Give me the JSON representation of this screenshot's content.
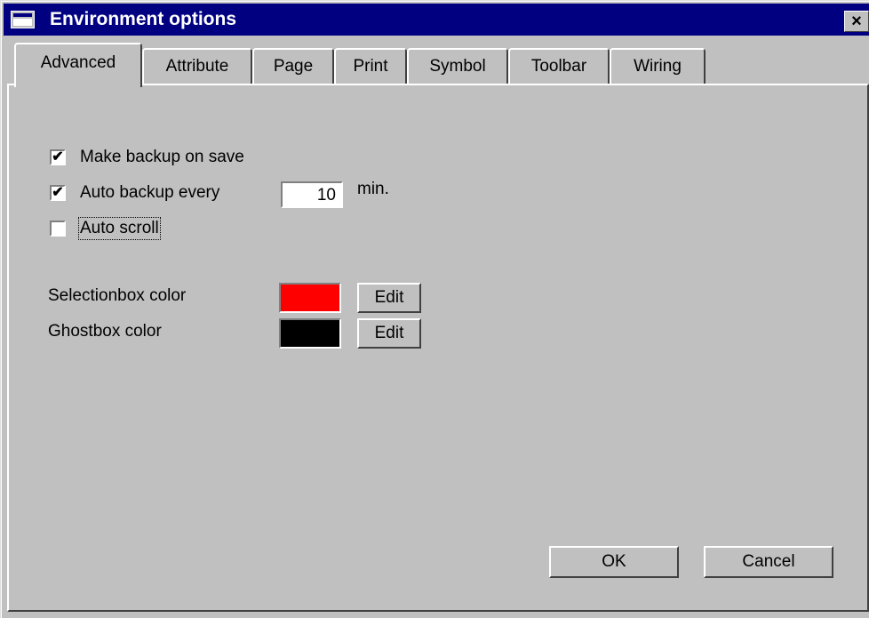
{
  "window": {
    "title": "Environment options",
    "close_label": "×"
  },
  "tabs": [
    "Advanced",
    "Attribute",
    "Page",
    "Print",
    "Symbol",
    "Toolbar",
    "Wiring"
  ],
  "options": {
    "make_backup": {
      "label": "Make backup on save",
      "checked": true
    },
    "auto_backup": {
      "label": "Auto backup every",
      "checked": true,
      "value": "10",
      "unit": "min."
    },
    "auto_scroll": {
      "label": "Auto scroll",
      "checked": false
    }
  },
  "colors": {
    "selectionbox": {
      "label": "Selectionbox color",
      "color": "#ff0000",
      "edit_label": "Edit"
    },
    "ghostbox": {
      "label": "Ghostbox color",
      "color": "#000000",
      "edit_label": "Edit"
    }
  },
  "buttons": {
    "ok": "OK",
    "cancel": "Cancel"
  }
}
